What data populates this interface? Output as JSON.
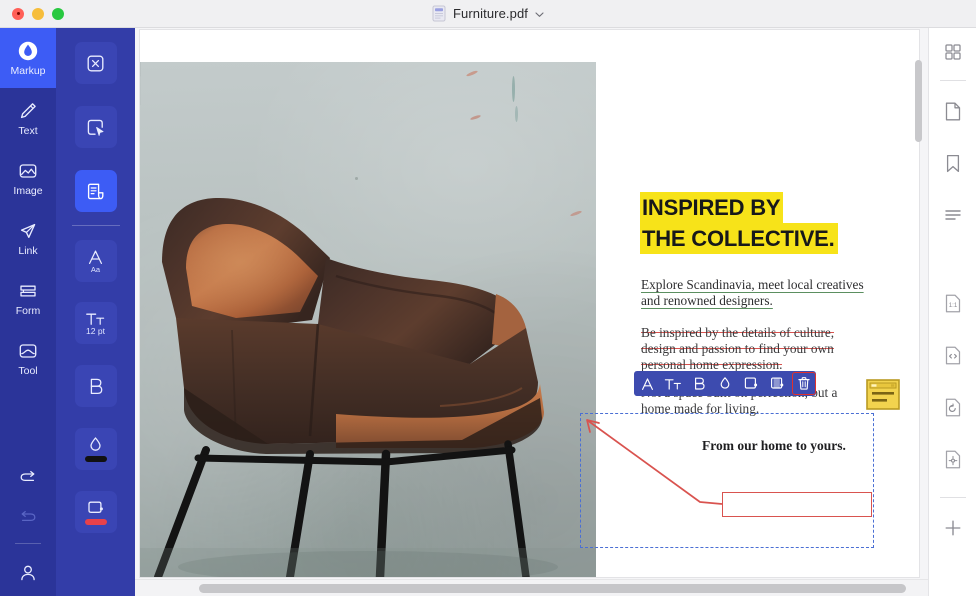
{
  "window": {
    "title": "Furniture.pdf",
    "controls": [
      "close",
      "minimize",
      "maximize"
    ]
  },
  "nav_rail": {
    "items": [
      {
        "label": "Markup",
        "icon": "markup-icon",
        "active": true
      },
      {
        "label": "Text",
        "icon": "pencil-icon",
        "active": false
      },
      {
        "label": "Image",
        "icon": "image-icon",
        "active": false
      },
      {
        "label": "Link",
        "icon": "link-send-icon",
        "active": false
      },
      {
        "label": "Form",
        "icon": "form-icon",
        "active": false
      },
      {
        "label": "Tool",
        "icon": "tool-icon",
        "active": false
      }
    ],
    "bottom": [
      {
        "name": "undo-button",
        "icon": "undo-icon",
        "enabled": true
      },
      {
        "name": "redo-button",
        "icon": "redo-icon",
        "enabled": false
      },
      {
        "name": "account-button",
        "icon": "user-icon",
        "enabled": true
      }
    ]
  },
  "tool_panel": {
    "items": [
      {
        "name": "deselect-tool",
        "icon": "close-box-icon",
        "selected": false
      },
      {
        "name": "select-tool",
        "icon": "cursor-box-icon",
        "selected": false
      },
      {
        "name": "note-tool",
        "icon": "note-page-icon",
        "selected": true
      },
      {
        "name": "font-family-tool",
        "icon": "font-a-icon",
        "sublabel": "Aa",
        "selected": false
      },
      {
        "name": "font-size-tool",
        "icon": "text-size-icon",
        "sublabel": "12 pt",
        "selected": false
      },
      {
        "name": "bold-tool",
        "icon": "bold-b-icon",
        "selected": false
      },
      {
        "name": "text-color-tool",
        "icon": "droplet-icon",
        "swatch": "#111111",
        "selected": false
      },
      {
        "name": "fill-color-tool",
        "icon": "fill-box-icon",
        "swatch": "#e8414a",
        "selected": false
      }
    ]
  },
  "document": {
    "heading_lines": [
      "INSPIRED BY",
      "THE COLLECTIVE."
    ],
    "subheading": "Explore Scandinavia, meet local creatives and renowned designers.",
    "paragraph_struck": "Be inspired by the details of culture, design and passion to find your own personal home expression.",
    "paragraph_plain": "Not a space built on perfection, but a home made for living.",
    "closing": "From our home to yours.",
    "highlight_color": "#f7e319",
    "strikethrough_color": "#d9534f",
    "underline_color": "#5b8f60"
  },
  "annotations": {
    "selection_box": {
      "name": "selection-bounding-box",
      "style": "dashed",
      "color": "#4a6fd4"
    },
    "arrow": {
      "name": "red-arrow-annotation",
      "color": "#d9534f"
    },
    "rectangle": {
      "name": "red-rectangle-annotation",
      "color": "#d9534f"
    },
    "sticky_note": {
      "name": "sticky-note-icon",
      "color": "#f2d34e"
    }
  },
  "float_toolbar": {
    "buttons": [
      {
        "name": "font-button",
        "icon": "letter-a-icon",
        "active": false
      },
      {
        "name": "text-size-button",
        "icon": "text-size-icon",
        "active": false
      },
      {
        "name": "bold-button",
        "icon": "bold-b-icon",
        "active": false
      },
      {
        "name": "color-button",
        "icon": "droplet-icon",
        "active": false
      },
      {
        "name": "note-add-button",
        "icon": "note-plus-icon",
        "active": false
      },
      {
        "name": "note-duplicate-button",
        "icon": "note-copy-icon",
        "active": false
      },
      {
        "name": "delete-button",
        "icon": "trash-icon",
        "active": true
      }
    ],
    "highlight_color": "#e0312d"
  },
  "right_sidebar": {
    "items": [
      {
        "name": "thumbnails-button",
        "icon": "grid-icon"
      },
      {
        "name": "pages-button",
        "icon": "page-icon"
      },
      {
        "name": "bookmarks-button",
        "icon": "bookmark-icon"
      },
      {
        "name": "outline-button",
        "icon": "list-lines-icon"
      },
      {
        "name": "fit-actual-size-button",
        "icon": "page-1to1-icon"
      },
      {
        "name": "page-code-button",
        "icon": "page-code-icon"
      },
      {
        "name": "rotate-page-button",
        "icon": "page-rotate-icon"
      },
      {
        "name": "extract-page-button",
        "icon": "page-move-icon"
      },
      {
        "name": "add-page-button",
        "icon": "plus-icon"
      }
    ]
  },
  "scrollbars": {
    "vertical": {
      "name": "vertical-scrollbar"
    },
    "horizontal": {
      "name": "horizontal-scrollbar"
    }
  }
}
